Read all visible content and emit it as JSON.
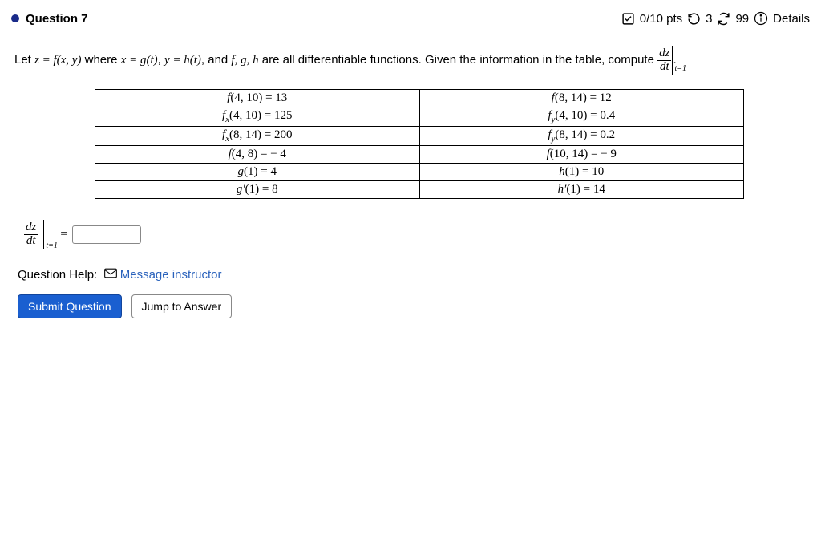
{
  "header": {
    "title": "Question 7",
    "score": "0/10 pts",
    "attempts_left": "3",
    "retries": "99",
    "details_label": "Details"
  },
  "prompt": {
    "part1": "Let ",
    "eq1": "z = f(x, y)",
    "part2": " where ",
    "eq2": "x = g(t)",
    "part3": ", ",
    "eq3": "y = h(t)",
    "part4": ", and ",
    "eq4": "f, g, h",
    "part5": " are all differentiable functions. Given the information in the table, compute ",
    "frac_num": "dz",
    "frac_den": "dt",
    "eval_sub": "t=1",
    "tail": "."
  },
  "table": {
    "rows": [
      {
        "l_fn": "f",
        "l_sub": "",
        "l_args": "(4, 10)",
        "l_val": "13",
        "r_fn": "f",
        "r_sub": "",
        "r_args": "(8, 14)",
        "r_val": "12"
      },
      {
        "l_fn": "f",
        "l_sub": "x",
        "l_args": "(4, 10)",
        "l_val": "125",
        "r_fn": "f",
        "r_sub": "y",
        "r_args": "(4, 10)",
        "r_val": "0.4"
      },
      {
        "l_fn": "f",
        "l_sub": "x",
        "l_args": "(8, 14)",
        "l_val": "200",
        "r_fn": "f",
        "r_sub": "y",
        "r_args": "(8, 14)",
        "r_val": "0.2"
      },
      {
        "l_fn": "f",
        "l_sub": "",
        "l_args": "(4, 8)",
        "l_val": " − 4",
        "r_fn": "f",
        "r_sub": "",
        "r_args": "(10, 14)",
        "r_val": " − 9"
      },
      {
        "l_fn": "g",
        "l_sub": "",
        "l_args": "(1)",
        "l_val": "4",
        "r_fn": "h",
        "r_sub": "",
        "r_args": "(1)",
        "r_val": "10"
      },
      {
        "l_fn": "g′",
        "l_sub": "",
        "l_args": "(1)",
        "l_val": "8",
        "r_fn": "h′",
        "r_sub": "",
        "r_args": "(1)",
        "r_val": "14"
      }
    ]
  },
  "answer": {
    "frac_num": "dz",
    "frac_den": "dt",
    "eval_sub": "t=1",
    "equals": " = ",
    "value": ""
  },
  "help": {
    "label": "Question Help:",
    "link": "Message instructor"
  },
  "buttons": {
    "submit": "Submit Question",
    "jump": "Jump to Answer"
  }
}
